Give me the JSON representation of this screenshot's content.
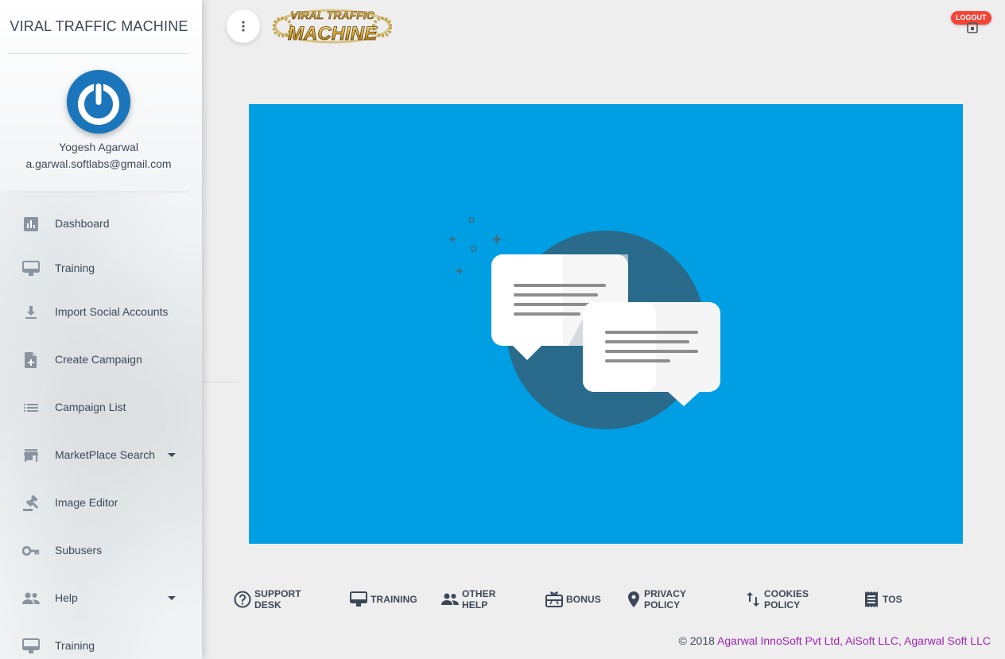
{
  "sidebar": {
    "brand": "VIRAL TRAFFIC MACHINE",
    "user": {
      "name": "Yogesh Agarwal",
      "email": "a.garwal.softlabs@gmail.com"
    },
    "items": [
      {
        "label": "Dashboard",
        "icon": "bar-chart-icon"
      },
      {
        "label": "Training",
        "icon": "monitor-icon"
      },
      {
        "label": "Import Social Accounts",
        "icon": "download-icon"
      },
      {
        "label": "Create Campaign",
        "icon": "note-add-icon"
      },
      {
        "label": "Campaign List",
        "icon": "list-icon"
      },
      {
        "label": "MarketPlace Search",
        "icon": "store-icon",
        "has_submenu": true
      },
      {
        "label": "Image Editor",
        "icon": "gavel-icon"
      },
      {
        "label": "Subusers",
        "icon": "key-icon"
      },
      {
        "label": "Help",
        "icon": "people-icon",
        "has_submenu": true
      },
      {
        "label": "Training",
        "icon": "monitor-icon"
      }
    ]
  },
  "header": {
    "logo_text": {
      "line1": "VIRAL TRAFFIC",
      "line2": "MACHINE"
    },
    "logout_label": "LOGOUT"
  },
  "footer": {
    "links": [
      {
        "label": "SUPPORT DESK",
        "icon": "help-circle-icon"
      },
      {
        "label": "TRAINING",
        "icon": "monitor-icon"
      },
      {
        "label": "OTHER HELP",
        "icon": "people-icon"
      },
      {
        "label": "BONUS",
        "icon": "gift-card-icon"
      },
      {
        "label": "PRIVACY POLICY",
        "icon": "location-pin-icon"
      },
      {
        "label": "COOKIES POLICY",
        "icon": "swap-vert-icon"
      },
      {
        "label": "TOS",
        "icon": "receipt-icon"
      }
    ],
    "copyright_prefix": "© 2018 ",
    "copyright_companies": "Agarwal InnoSoft Pvt Ltd, AiSoft LLC, Agarwal Soft LLC"
  },
  "colors": {
    "hero_bg": "#009fe3",
    "accent_purple": "#9c27b0",
    "logout_red": "#f44336",
    "avatar_blue": "#1b75bb"
  }
}
